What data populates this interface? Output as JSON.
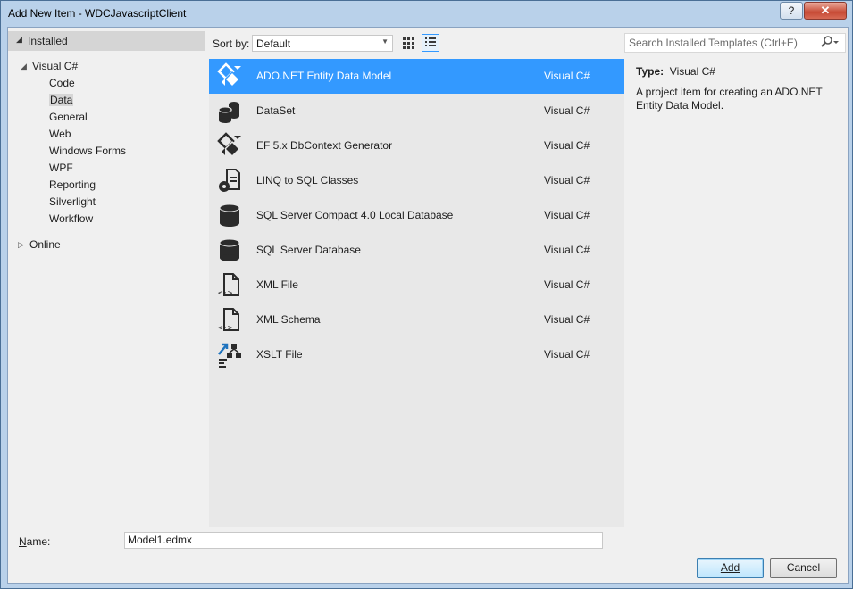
{
  "window": {
    "title": "Add New Item - WDCJavascriptClient",
    "help_label": "?",
    "close_label": "✕"
  },
  "tree": {
    "installed_label": "Installed",
    "visual_csharp_label": "Visual C#",
    "children": [
      "Code",
      "Data",
      "General",
      "Web",
      "Windows Forms",
      "WPF",
      "Reporting",
      "Silverlight",
      "Workflow"
    ],
    "selected": "Data",
    "online_label": "Online"
  },
  "sort": {
    "label": "Sort by:",
    "value": "Default"
  },
  "search": {
    "placeholder": "Search Installed Templates (Ctrl+E)"
  },
  "templates": [
    {
      "name": "ADO.NET Entity Data Model",
      "lang": "Visual C#",
      "icon": "entity-model-icon",
      "selected": true
    },
    {
      "name": "DataSet",
      "lang": "Visual C#",
      "icon": "dataset-icon"
    },
    {
      "name": "EF 5.x DbContext Generator",
      "lang": "Visual C#",
      "icon": "dbcontext-generator-icon"
    },
    {
      "name": "LINQ to SQL Classes",
      "lang": "Visual C#",
      "icon": "linq-to-sql-icon"
    },
    {
      "name": "SQL Server Compact 4.0 Local Database",
      "lang": "Visual C#",
      "icon": "database-icon"
    },
    {
      "name": "SQL Server Database",
      "lang": "Visual C#",
      "icon": "database-icon"
    },
    {
      "name": "XML File",
      "lang": "Visual C#",
      "icon": "xml-file-icon"
    },
    {
      "name": "XML Schema",
      "lang": "Visual C#",
      "icon": "xml-schema-icon"
    },
    {
      "name": "XSLT File",
      "lang": "Visual C#",
      "icon": "xslt-file-icon"
    }
  ],
  "details": {
    "type_label": "Type:",
    "type_value": "Visual C#",
    "description": "A project item for creating an ADO.NET Entity Data Model."
  },
  "footer": {
    "name_label": "Name:",
    "name_value": "Model1.edmx",
    "add_label": "Add",
    "cancel_label": "Cancel"
  },
  "colors": {
    "selection": "#3399ff",
    "list_bg": "#e8e8e8",
    "frame": "#b9d1ea"
  }
}
